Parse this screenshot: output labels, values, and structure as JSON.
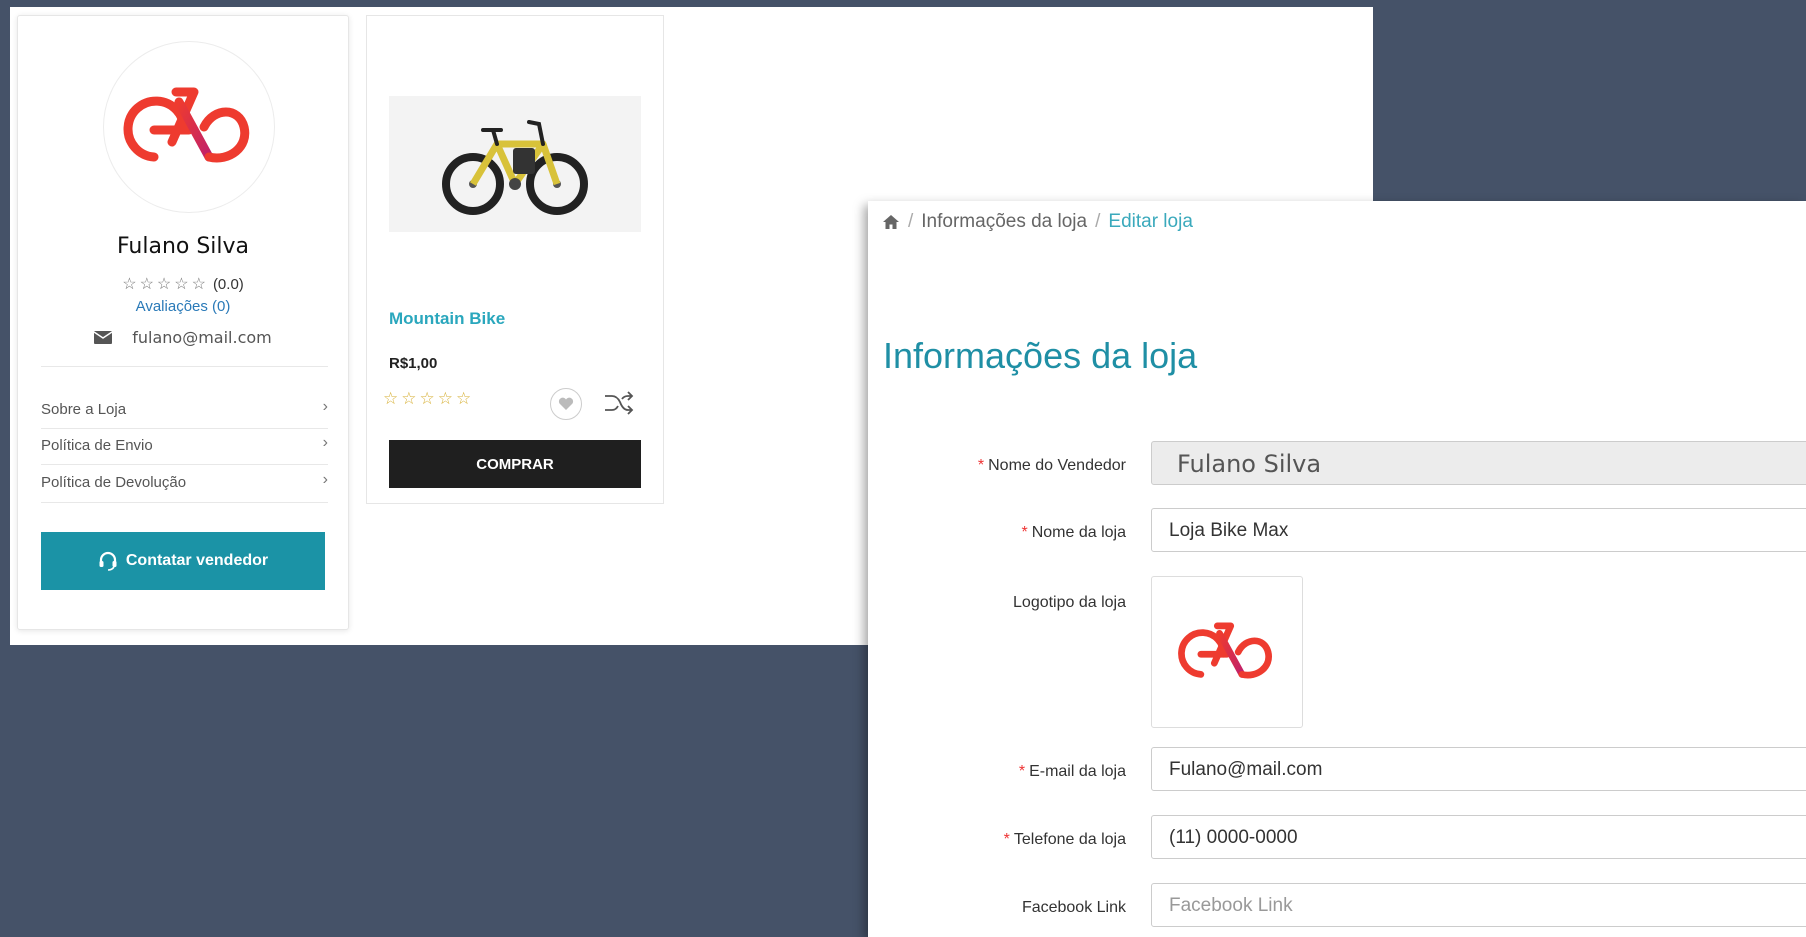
{
  "storefront": {
    "vendor": {
      "name": "Fulano Silva",
      "stars": "☆☆☆☆☆",
      "rating_text": "(0.0)",
      "reviews_link": "Avaliações (0)",
      "email": "fulano@mail.com",
      "menu": [
        {
          "label": "Sobre a Loja"
        },
        {
          "label": "Política de Envio"
        },
        {
          "label": "Política de Devolução"
        }
      ],
      "chevron": "›",
      "contact_button": "Contatar vendedor"
    },
    "product": {
      "title": "Mountain Bike",
      "price": "R$1,00",
      "stars": "☆☆☆☆☆",
      "buy_button": "COMPRAR"
    }
  },
  "admin": {
    "breadcrumb": {
      "separator": "/",
      "items": [
        "Informações da loja",
        "Editar loja"
      ]
    },
    "title": "Informações da loja",
    "required_marker": "*",
    "fields": {
      "vendor_name": {
        "label": "Nome do Vendedor",
        "value": "Fulano Silva"
      },
      "store_name": {
        "label": "Nome da loja",
        "value": "Loja Bike Max"
      },
      "store_logo": {
        "label": "Logotipo da loja"
      },
      "store_email": {
        "label": "E-mail da loja",
        "value": "Fulano@mail.com"
      },
      "store_phone": {
        "label": "Telefone da loja",
        "value": "(11) 0000-0000"
      },
      "facebook": {
        "label": "Facebook Link",
        "placeholder": "Facebook Link"
      }
    }
  },
  "colors": {
    "background": "#455268",
    "accent_teal": "#1b93a6",
    "logo_red": "#ee3b2f",
    "logo_magenta": "#c0206a",
    "star_gold": "#d8b23a"
  },
  "icons": [
    "bike-logo-icon",
    "envelope-icon",
    "chevron-right-icon",
    "headset-icon",
    "heart-icon",
    "shuffle-icon",
    "home-icon"
  ]
}
